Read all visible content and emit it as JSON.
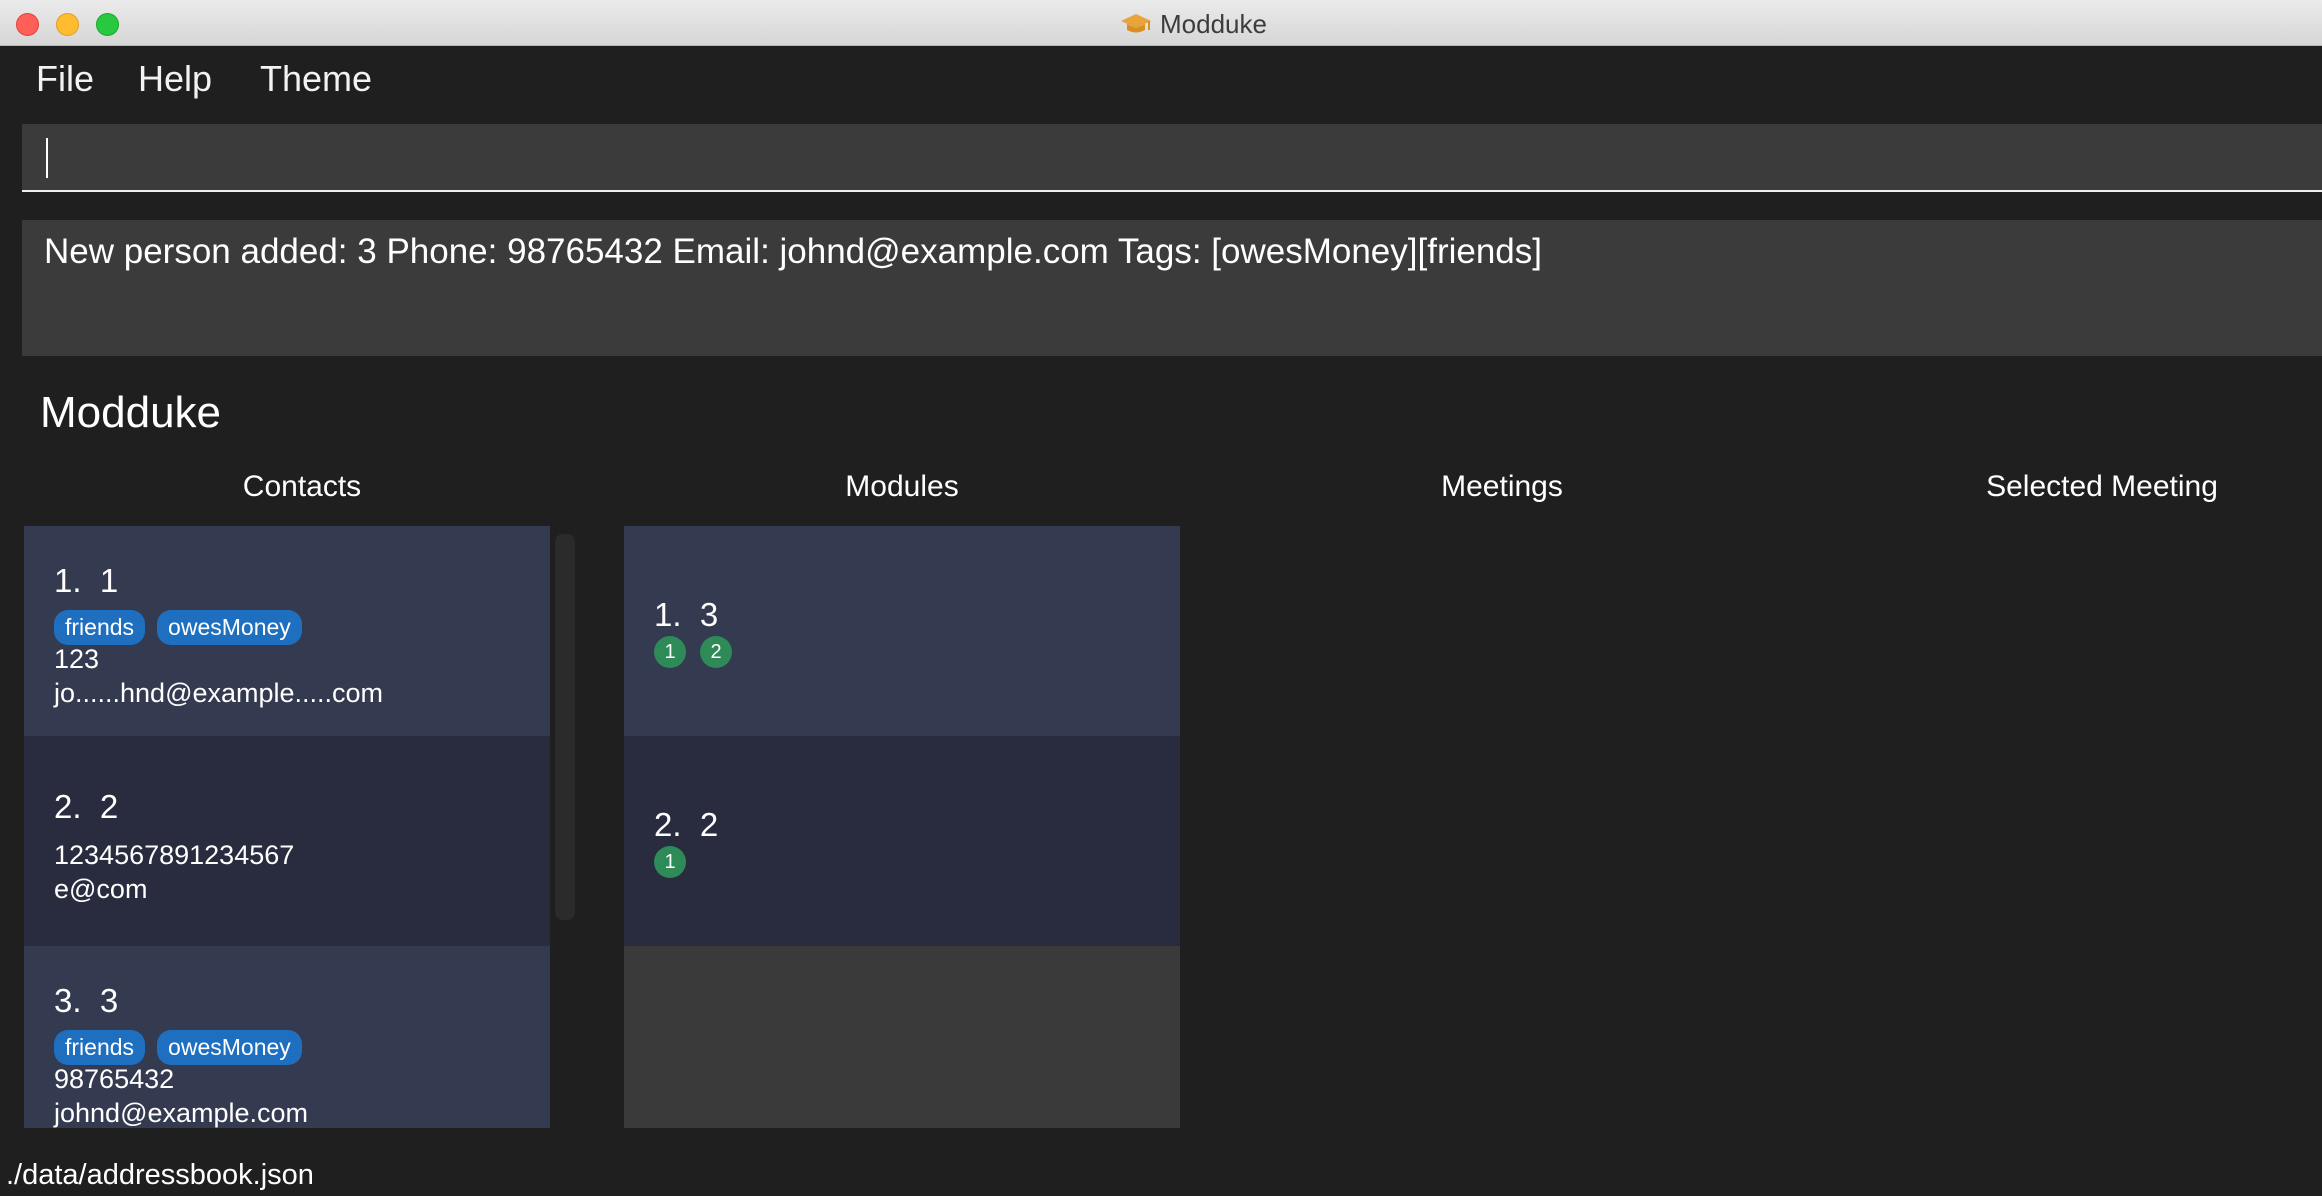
{
  "window": {
    "title": "Modduke"
  },
  "menu": {
    "items": [
      "File",
      "Help",
      "Theme"
    ]
  },
  "command_box": {
    "value": ""
  },
  "result_display": {
    "text": "New person added: 3 Phone: 98765432 Email: johnd@example.com Tags: [owesMoney][friends]"
  },
  "app_name": "Modduke",
  "columns": {
    "contacts": "Contacts",
    "modules": "Modules",
    "meetings": "Meetings",
    "selected_meeting": "Selected Meeting"
  },
  "contacts": [
    {
      "index": "1.",
      "name": "1",
      "tags": [
        "friends",
        "owesMoney"
      ],
      "phone": "123",
      "email": "jo......hnd@example.....com"
    },
    {
      "index": "2.",
      "name": "2",
      "tags": [],
      "phone": "1234567891234567",
      "email": "e@com"
    },
    {
      "index": "3.",
      "name": "3",
      "tags": [
        "friends",
        "owesMoney"
      ],
      "phone": "98765432",
      "email": "johnd@example.com"
    }
  ],
  "modules": [
    {
      "index": "1.",
      "name": "3",
      "members": [
        "1",
        "2"
      ]
    },
    {
      "index": "2.",
      "name": "2",
      "members": [
        "1"
      ]
    }
  ],
  "status_bar": {
    "path": "./data/addressbook.json"
  },
  "icons": {
    "app_icon": "graduation-cap-icon"
  },
  "colors": {
    "tag": "#1f6fc1",
    "member_badge": "#2e8b57",
    "card_light": "#343a50",
    "card_dark": "#282c3e",
    "background": "#1f1f1f"
  }
}
